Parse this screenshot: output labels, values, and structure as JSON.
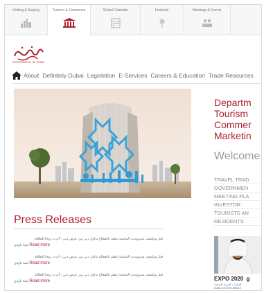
{
  "top_tabs": [
    {
      "label": "Visiting & Staying",
      "icon": "skyline-icon",
      "active": false
    },
    {
      "label": "Tourism & Commerce",
      "icon": "building-icon",
      "active": true
    },
    {
      "label": "Global Calendar",
      "icon": "calendar-icon",
      "active": false
    },
    {
      "label": "Festivals",
      "icon": "fireworks-icon",
      "active": false
    },
    {
      "label": "Meetings & Events",
      "icon": "meeting-icon",
      "active": false
    }
  ],
  "logo": {
    "subtitle": "GOVERNMENT OF DUBAI"
  },
  "main_nav": [
    "About",
    "Definitely Dubai",
    "Legislation",
    "E-Services",
    "Careers & Education",
    "Trade Resources"
  ],
  "right_column": {
    "title_lines": [
      "Departm",
      "Tourism",
      "Commer",
      "Marketin"
    ],
    "welcome": "Welcome",
    "links": [
      "TRAVEL TRAD",
      "GOVERNMEN",
      "MEETING PLA",
      "INVESTOR",
      "TOURISTS AN",
      "RESIDENTS"
    ],
    "expo_title": "EXPO 2020",
    "expo_letter": "g",
    "expo_arabic": "الإمارات العربية المتحدة",
    "expo_place": "DUBAI, UNITED ARAB E"
  },
  "press": {
    "title": "Press Releases",
    "items": [
      {
        "arabic": "قبل وتكشف سترويدت الماضية تنظم بالقطاع تداول دبي بين عرض دبي - أبدت زوجا للطاقة",
        "tail": "لعبة باودي",
        "read_more": "Read more"
      },
      {
        "arabic": "قبل وتكشف سترويدت الماضية تنظم بالقطاع تداول دبي بين عرض دبي - أبدت زوجا للطاقة",
        "tail": "لعبة باودي",
        "read_more": "Read more"
      },
      {
        "arabic": "قبل وتكشف سترويدت الماضية تنظم بالقطاع تداول دبي بين عرض دبي - أبدت زوجا للطاقة",
        "tail": "لعبة باودي",
        "read_more": "Read more"
      }
    ]
  },
  "colors": {
    "accent": "#b01e2e",
    "hero_sign": "#3aa3d8"
  }
}
